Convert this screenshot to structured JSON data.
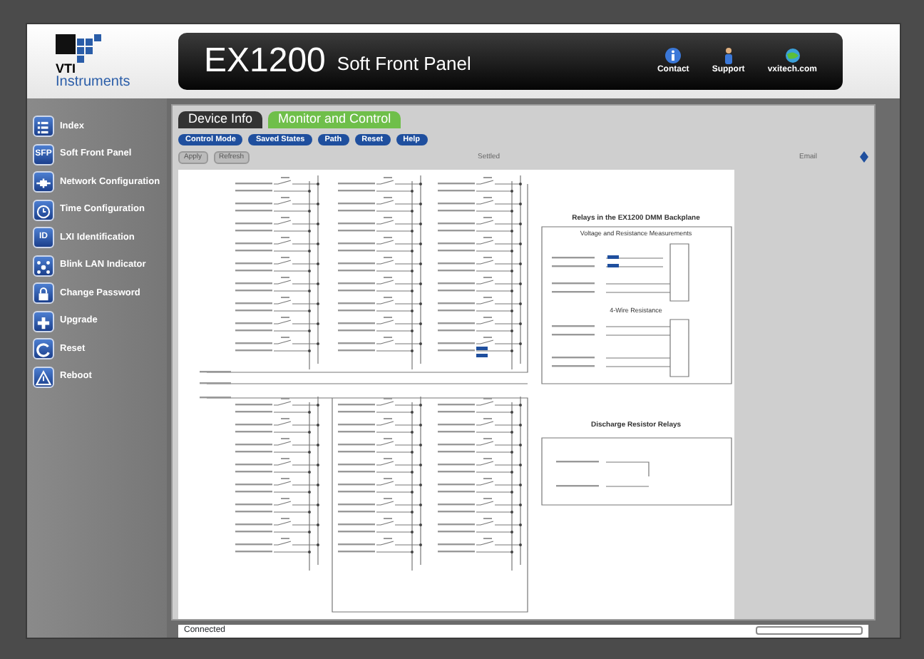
{
  "header": {
    "logo_text": "VTI",
    "logo_subtext": "Instruments",
    "title": "EX1200",
    "subtitle": "Soft Front Panel",
    "links": [
      {
        "label": "Contact",
        "kind": "info"
      },
      {
        "label": "Support",
        "kind": "person"
      },
      {
        "label": "vxitech.com",
        "kind": "globe"
      }
    ]
  },
  "sidebar": {
    "items": [
      {
        "label": "Index",
        "kind": "list"
      },
      {
        "label": "Soft Front Panel",
        "kind": "letters",
        "icon_text": "SFP"
      },
      {
        "label": "Network Configuration",
        "kind": "network"
      },
      {
        "label": "Time Configuration",
        "kind": "clock"
      },
      {
        "label": "LXI Identification",
        "kind": "letters",
        "icon_text": "ID"
      },
      {
        "label": "Blink LAN Indicator",
        "kind": "blink"
      },
      {
        "label": "Change Password",
        "kind": "lock"
      },
      {
        "label": "Upgrade",
        "kind": "plus"
      },
      {
        "label": "Reset",
        "kind": "reset"
      },
      {
        "label": "Reboot",
        "kind": "warning"
      }
    ]
  },
  "tabs": [
    {
      "label": "Device Info",
      "selected": false
    },
    {
      "label": "Monitor and Control",
      "selected": true
    }
  ],
  "subtabs": [
    "Control Mode",
    "Saved States",
    "Path",
    "Reset",
    "Help"
  ],
  "toolbar": {
    "buttons": [
      "Apply",
      "Refresh"
    ],
    "column_2": "Settled",
    "column_3": "Email"
  },
  "schematic": {
    "headings": [
      "Relays in the EX1200 DMM Backplane",
      "Voltage and Resistance Measurements",
      "4-Wire Resistance",
      "Discharge Resistor Relays"
    ]
  },
  "status": {
    "text": "Connected"
  }
}
